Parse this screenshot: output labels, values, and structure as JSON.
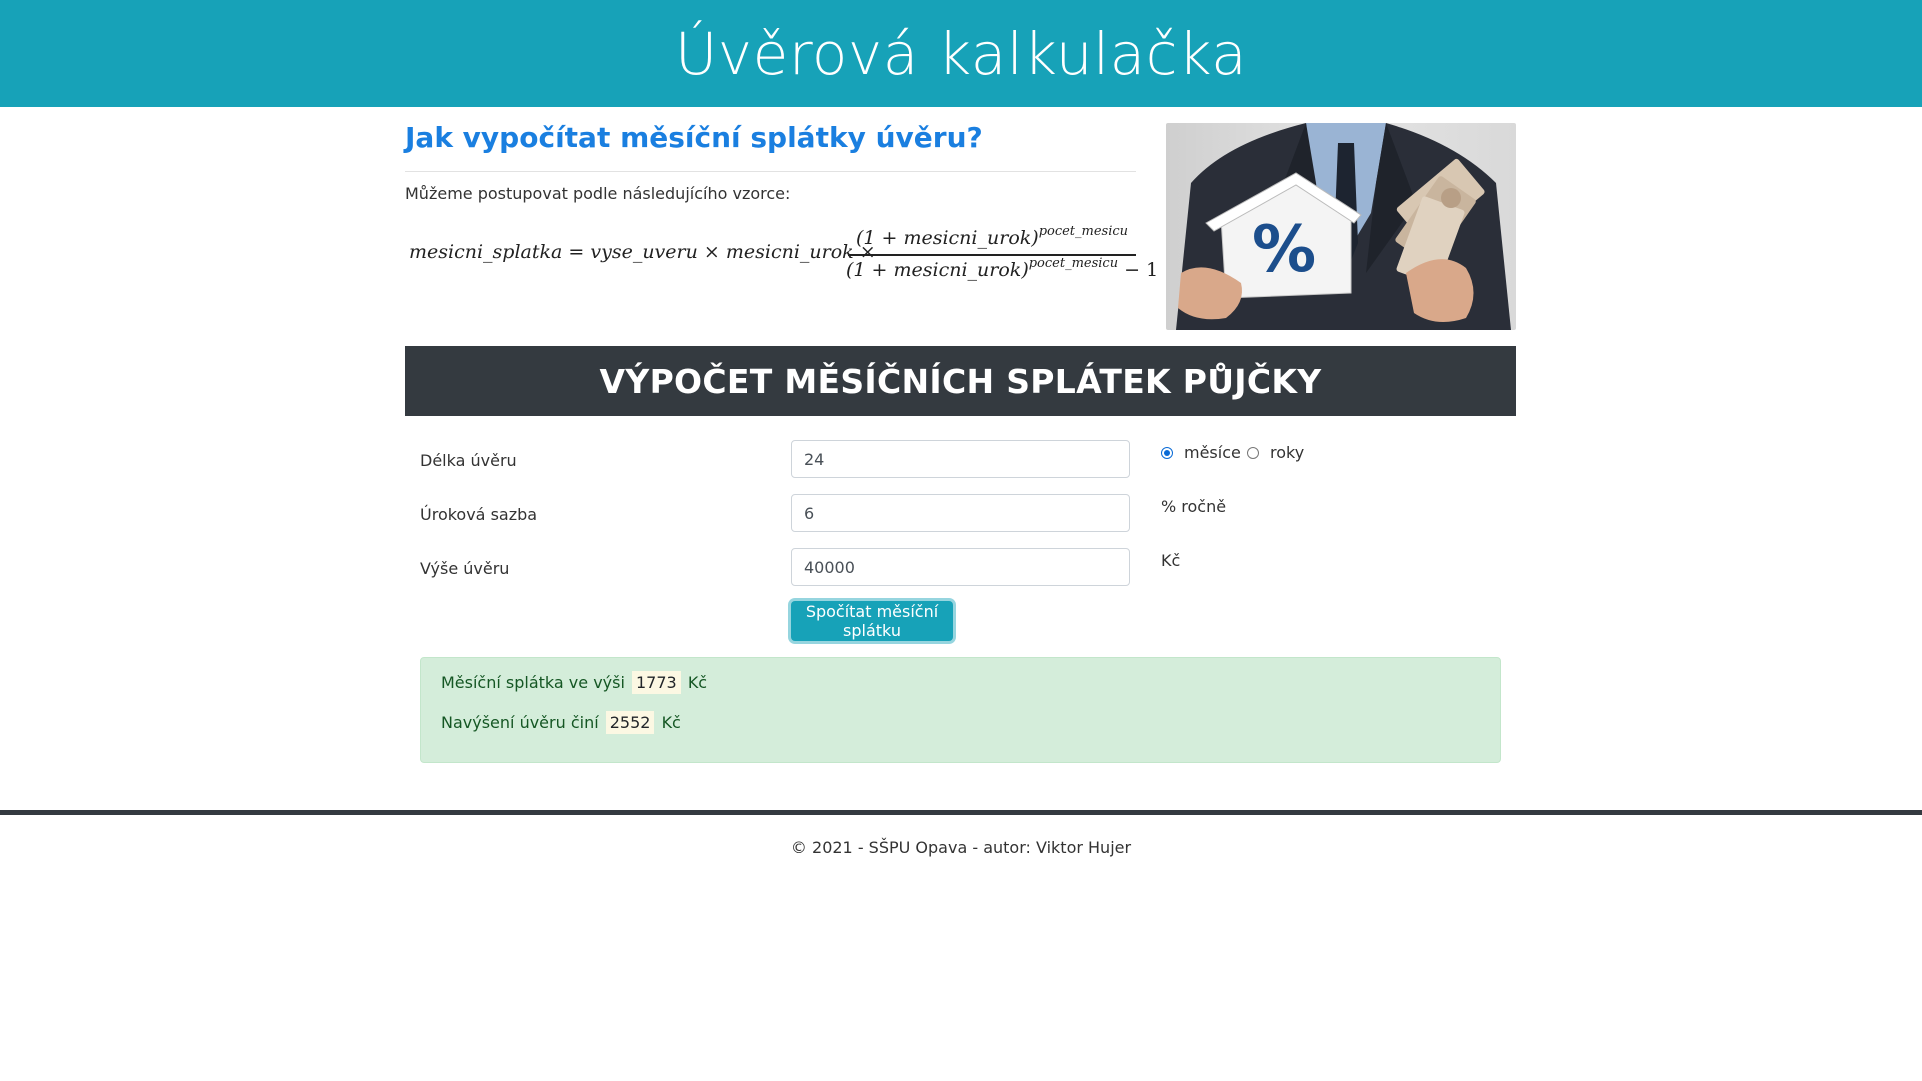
{
  "header": {
    "title": "Úvěrová kalkulačka"
  },
  "intro": {
    "title": "Jak vypočítat měsíční splátky úvěru?",
    "text": "Můžeme postupovat podle následujícího vzorce:",
    "formula": {
      "lhs": "mesicni_splatka",
      "equals": "=",
      "term1": "vyse_uveru",
      "times": "×",
      "term2": "mesicni_urok",
      "numerator_base": "(1 + mesicni_urok)",
      "numerator_exp": "pocet_mesicu",
      "denominator_base": "(1 + mesicni_urok)",
      "denominator_exp": "pocet_mesicu",
      "denominator_tail": "− 1"
    },
    "image_icon": "percent-house-photo",
    "image_symbol": "%"
  },
  "calculator": {
    "title": "VÝPOČET MĚSÍČNÍCH SPLÁTEK PŮJČKY",
    "rows": [
      {
        "label": "Délka úvěru",
        "value": "24"
      },
      {
        "label": "Úroková sazba",
        "value": "6",
        "unit": "% ročně"
      },
      {
        "label": "Výše úvěru",
        "value": "40000",
        "unit": "Kč"
      }
    ],
    "period_options": [
      {
        "label": "měsíce",
        "checked": true
      },
      {
        "label": "roky",
        "checked": false
      }
    ],
    "submit_label": "Spočítat měsíční splátku"
  },
  "result": {
    "monthly_prefix": "Měsíční splátka ve výši",
    "monthly_value": "1773",
    "monthly_suffix": "Kč",
    "increase_prefix": "Navýšení úvěru činí",
    "increase_value": "2552",
    "increase_suffix": "Kč"
  },
  "footer": {
    "text": "© 2021 - SŠPU Opava - autor: Viktor Hujer"
  },
  "colors": {
    "header_bg": "#17a2b8",
    "calc_header_bg": "#343a40",
    "title_blue": "#1a7fe0",
    "result_bg": "#d4edda"
  }
}
